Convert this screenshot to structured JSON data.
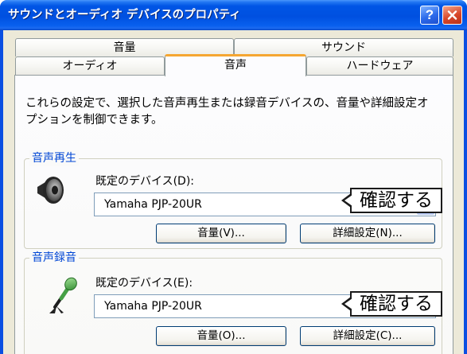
{
  "window": {
    "title": "サウンドとオーディオ デバイスのプロパティ",
    "help_label": "?"
  },
  "tabs": {
    "row1": [
      {
        "label": "音量",
        "selected": false
      },
      {
        "label": "サウンド",
        "selected": false
      }
    ],
    "row2": [
      {
        "label": "オーディオ",
        "selected": false
      },
      {
        "label": "音声",
        "selected": true
      },
      {
        "label": "ハードウェア",
        "selected": false
      }
    ]
  },
  "description": {
    "lines": [
      "これらの設定で、選択した音声再生または録音デバイスの、音量や詳細設定オ",
      "プションを制御できます。"
    ]
  },
  "playback": {
    "group_label": "音声再生",
    "device_label": "既定のデバイス(D):",
    "device_value": "Yamaha PJP-20UR",
    "callout": "確認する",
    "volume_button": "音量(V)...",
    "advanced_button": "詳細設定(N)..."
  },
  "recording": {
    "group_label": "音声録音",
    "device_label": "既定のデバイス(E):",
    "device_value": "Yamaha PJP-20UR",
    "callout": "確認する",
    "volume_button": "音量(O)...",
    "advanced_button": "詳細設定(C)..."
  },
  "icons": {
    "help": "help-icon",
    "close": "close-icon",
    "playback": "speaker-icon",
    "recording": "microphone-icon",
    "dropdown": "chevron-down-icon"
  },
  "colors": {
    "title_bar": "#0055E5",
    "group_label_text": "#0046D5",
    "selected_tab_accent": "#F5A631",
    "close_button": "#D8472A",
    "help_button": "#2C6BEB",
    "dialog_background": "#ECE9D8"
  }
}
